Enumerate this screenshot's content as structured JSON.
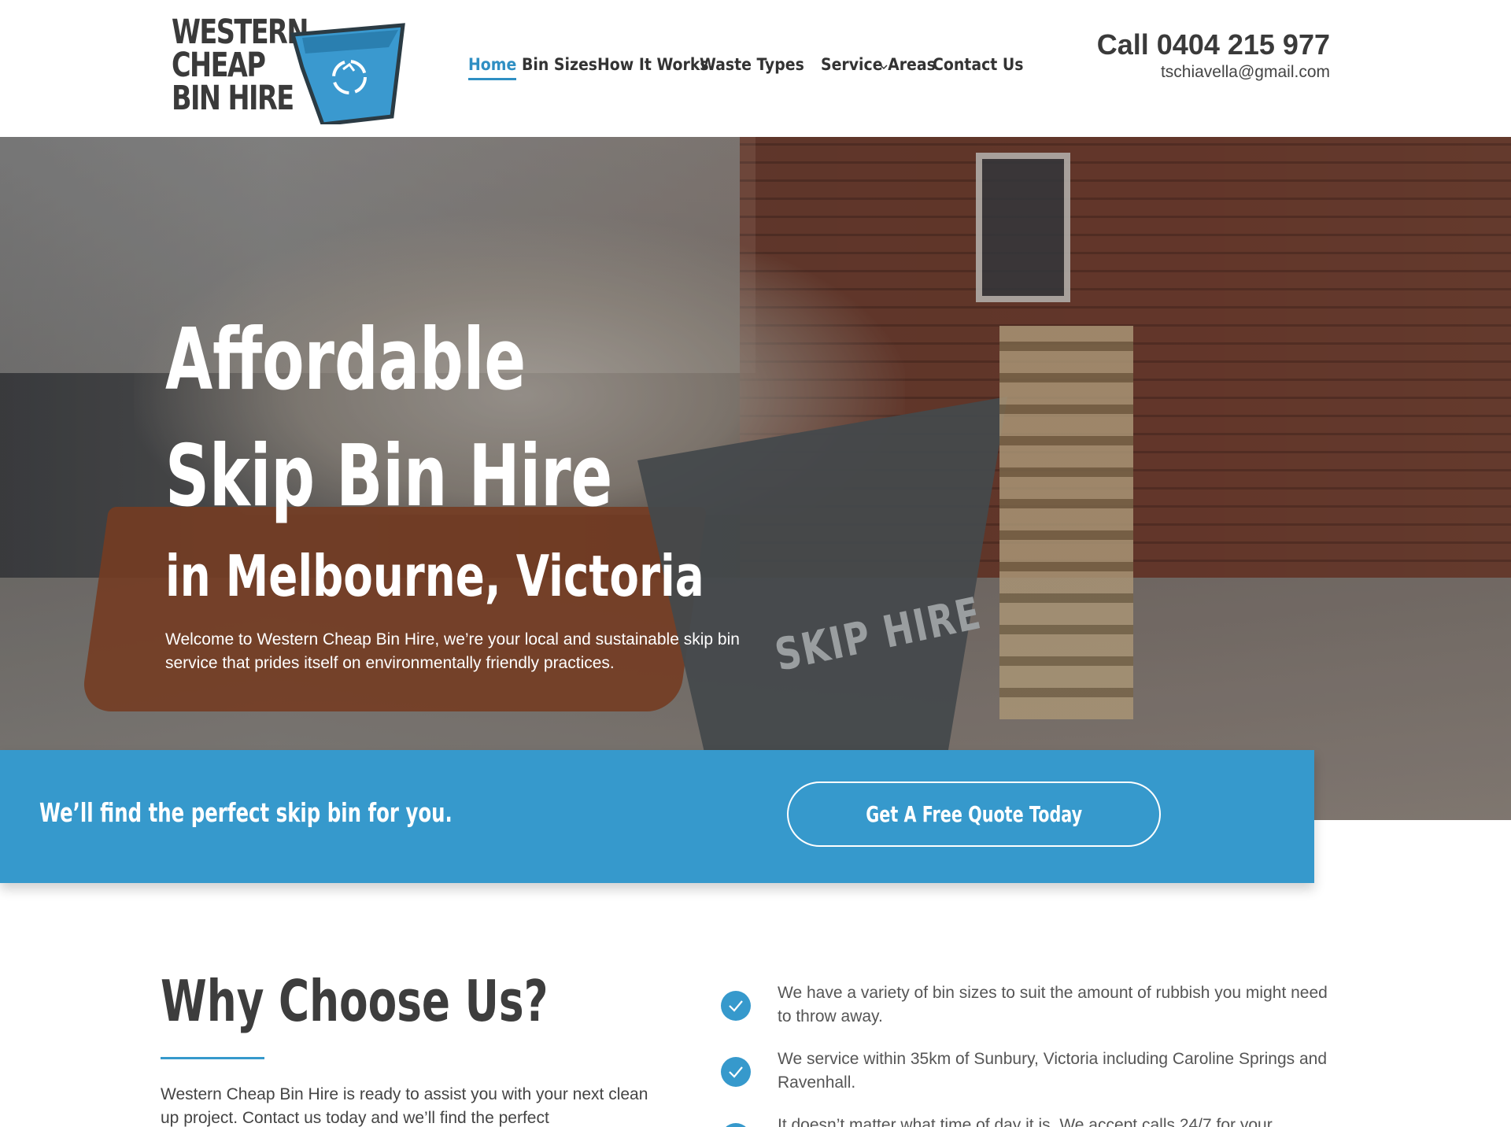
{
  "brand": {
    "logo_line1": "WESTERN",
    "logo_line2": "CHEAP",
    "logo_line3": "BIN HIRE",
    "accent_color": "#3699cc"
  },
  "nav": {
    "items": [
      {
        "label": "Home",
        "active": true
      },
      {
        "label": "Bin Sizes"
      },
      {
        "label": "How It Works"
      },
      {
        "label": "Waste Types",
        "dropdown": true
      },
      {
        "label": "Service Areas"
      },
      {
        "label": "Contact Us"
      }
    ]
  },
  "contact": {
    "phone": "Call 0404 215 977",
    "email": "tschiavella@gmail.com"
  },
  "hero": {
    "title_line1": "Affordable",
    "title_line2": "Skip Bin Hire",
    "title_line3": "in Melbourne, Victoria",
    "description": "Welcome to Western Cheap Bin Hire, we’re your local and sustainable skip bin service that prides itself on environmentally friendly practices.",
    "image_label": "SKIP HIRE"
  },
  "cta": {
    "text": "We’ll find the perfect skip bin for you.",
    "button_label": "Get A Free Quote Today"
  },
  "why": {
    "title": "Why Choose Us?",
    "paragraph": "Western Cheap Bin Hire is ready to assist you with your next clean up project. Contact us today and we’ll find the perfect",
    "benefits": [
      "We have a variety of bin sizes to suit the amount of rubbish you might need to throw away.",
      "We service within 35km of Sunbury, Victoria including Caroline Springs and Ravenhall.",
      "It doesn’t matter what time of day it is. We accept calls 24/7 for your"
    ]
  }
}
